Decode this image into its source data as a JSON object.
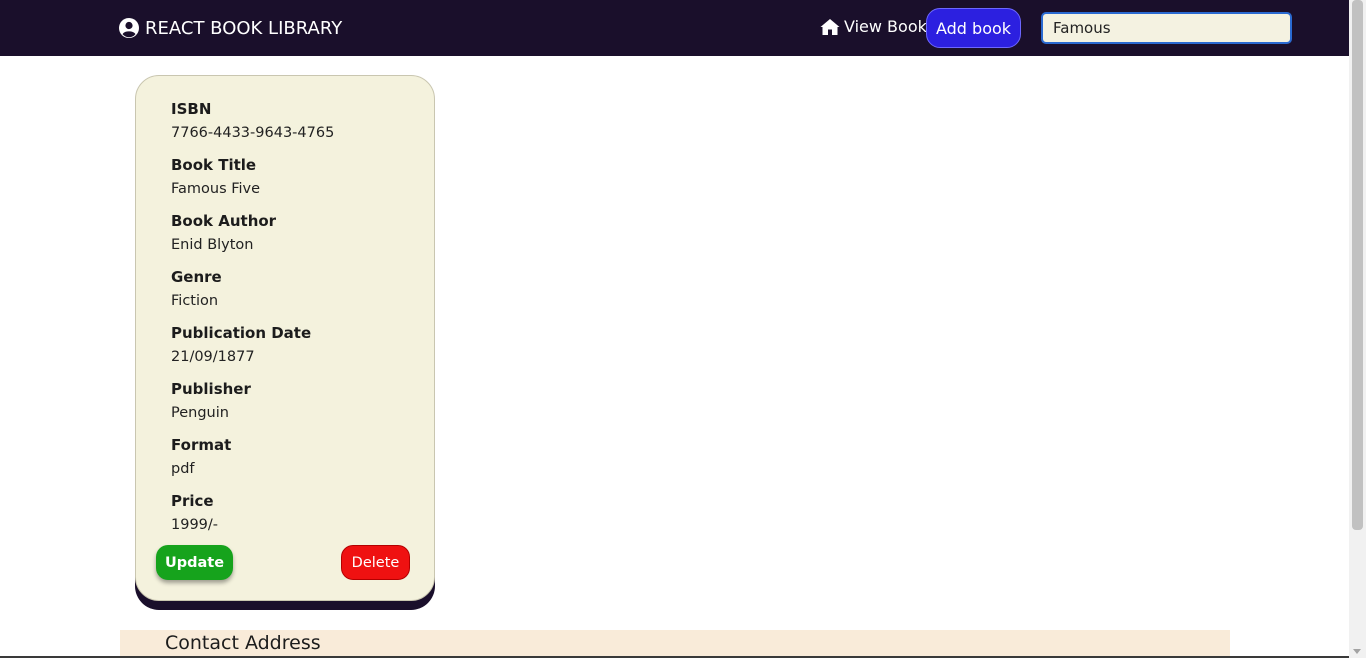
{
  "navbar": {
    "brand": "REACT BOOK LIBRARY",
    "brand_icon": "user-circle-icon",
    "view_link": "View Book",
    "view_icon": "home-icon",
    "add_button": "Add book",
    "search_value": "Famous"
  },
  "book": {
    "isbn_label": "ISBN",
    "isbn": "7766-4433-9643-4765",
    "title_label": "Book Title",
    "title": "Famous Five",
    "author_label": "Book Author",
    "author": "Enid Blyton",
    "genre_label": "Genre",
    "genre": "Fiction",
    "pubdate_label": "Publication Date",
    "pubdate": "21/09/1877",
    "publisher_label": "Publisher",
    "publisher": "Penguin",
    "format_label": "Format",
    "format": "pdf",
    "price_label": "Price",
    "price": "1999/-",
    "update_button": "Update",
    "delete_button": "Delete"
  },
  "footer": {
    "contact_title": "Contact Address"
  },
  "colors": {
    "navbar_bg": "#1a0f2b",
    "add_button_bg": "#2c20e0",
    "card_bg": "#f4f2dd",
    "update_bg": "#16a31c",
    "delete_bg": "#ef1111",
    "contact_bg": "#f9ebd9"
  }
}
